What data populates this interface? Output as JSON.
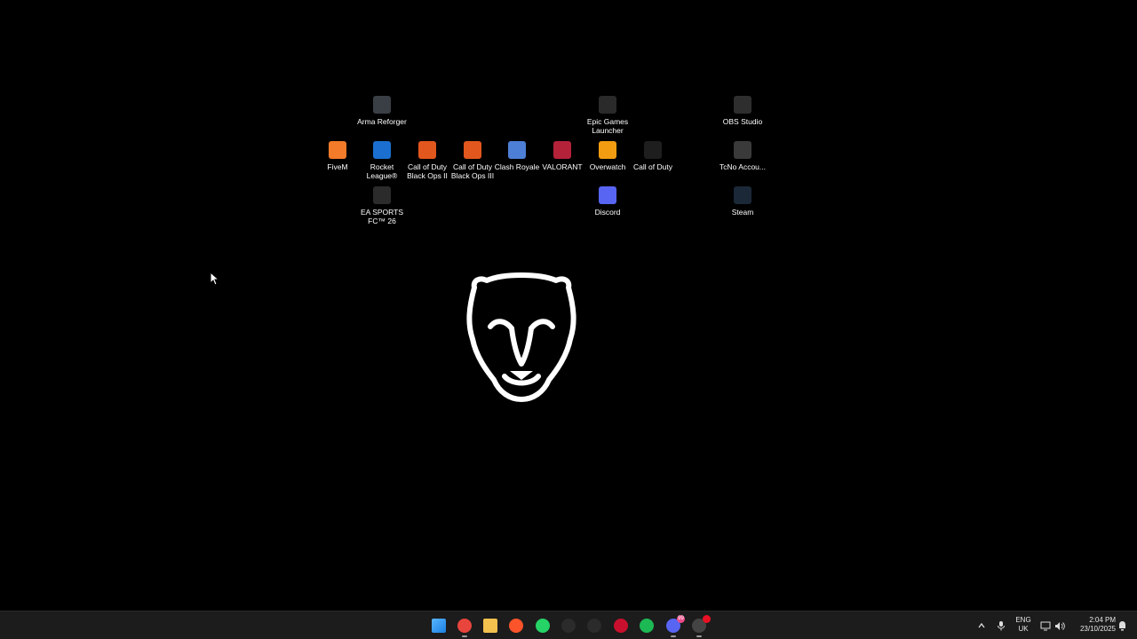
{
  "desktop": {
    "icons": [
      {
        "label": "Arma Reforger",
        "icon": "arma-reforger-icon",
        "color": "#3a3f45"
      },
      {
        "label": "Epic Games Launcher",
        "icon": "epic-games-icon",
        "color": "#2a2a2a"
      },
      {
        "label": "OBS Studio",
        "icon": "obs-studio-icon",
        "color": "#2e2e2e"
      },
      {
        "label": "FiveM",
        "icon": "fivem-icon",
        "color": "#f47b2a"
      },
      {
        "label": "Rocket League®",
        "icon": "rocket-league-icon",
        "color": "#1b6fd1"
      },
      {
        "label": "Call of Duty Black Ops II",
        "icon": "cod-bo2-icon",
        "color": "#e2571e"
      },
      {
        "label": "Call of Duty Black Ops III",
        "icon": "cod-bo3-icon",
        "color": "#e2571e"
      },
      {
        "label": "Clash Royale",
        "icon": "clash-royale-icon",
        "color": "#4d7fd6"
      },
      {
        "label": "VALORANT",
        "icon": "valorant-icon",
        "color": "#b4223a"
      },
      {
        "label": "Overwatch",
        "icon": "overwatch-icon",
        "color": "#f39c12"
      },
      {
        "label": "Call of Duty",
        "icon": "call-of-duty-icon",
        "color": "#1e1e1e"
      },
      {
        "label": "TcNo Accou...",
        "icon": "tcno-account-switcher-icon",
        "color": "#3a3a3a"
      },
      {
        "label": "EA SPORTS FC™ 26",
        "icon": "ea-sports-fc-icon",
        "color": "#2b2b2b"
      },
      {
        "label": "Discord",
        "icon": "discord-icon",
        "color": "#5865f2"
      },
      {
        "label": "Steam",
        "icon": "steam-icon",
        "color": "#1b2838"
      }
    ]
  },
  "wallpaper": {
    "logo": "panther-head-logo"
  },
  "taskbar": {
    "apps": [
      {
        "name": "start-button",
        "icon": "windows-logo-icon",
        "color": "#3aa0ff",
        "running": false
      },
      {
        "name": "taskbar-chrome",
        "icon": "chrome-icon",
        "color": "#e8453c",
        "running": true
      },
      {
        "name": "taskbar-file-explorer",
        "icon": "folder-icon",
        "color": "#f2c14e",
        "running": false
      },
      {
        "name": "taskbar-brave",
        "icon": "brave-icon",
        "color": "#fb542b",
        "running": false
      },
      {
        "name": "taskbar-whatsapp",
        "icon": "whatsapp-icon",
        "color": "#25d366",
        "running": false
      },
      {
        "name": "taskbar-app-g",
        "icon": "g-hub-icon",
        "color": "#2b2b2b",
        "running": false
      },
      {
        "name": "taskbar-app-ring",
        "icon": "capture-icon",
        "color": "#2b2b2b",
        "running": false
      },
      {
        "name": "taskbar-app-red",
        "icon": "red-app-icon",
        "color": "#c8102e",
        "running": false
      },
      {
        "name": "taskbar-spotify",
        "icon": "spotify-icon",
        "color": "#1db954",
        "running": false
      },
      {
        "name": "taskbar-discord",
        "icon": "discord-icon",
        "color": "#5865f2",
        "running": true,
        "badge": "99"
      },
      {
        "name": "taskbar-app-last",
        "icon": "app-icon",
        "color": "#444444",
        "running": true,
        "badge": ""
      }
    ]
  },
  "tray": {
    "lang_line1": "ENG",
    "lang_line2": "UK",
    "time": "2:04 PM",
    "date": "23/10/2025"
  }
}
